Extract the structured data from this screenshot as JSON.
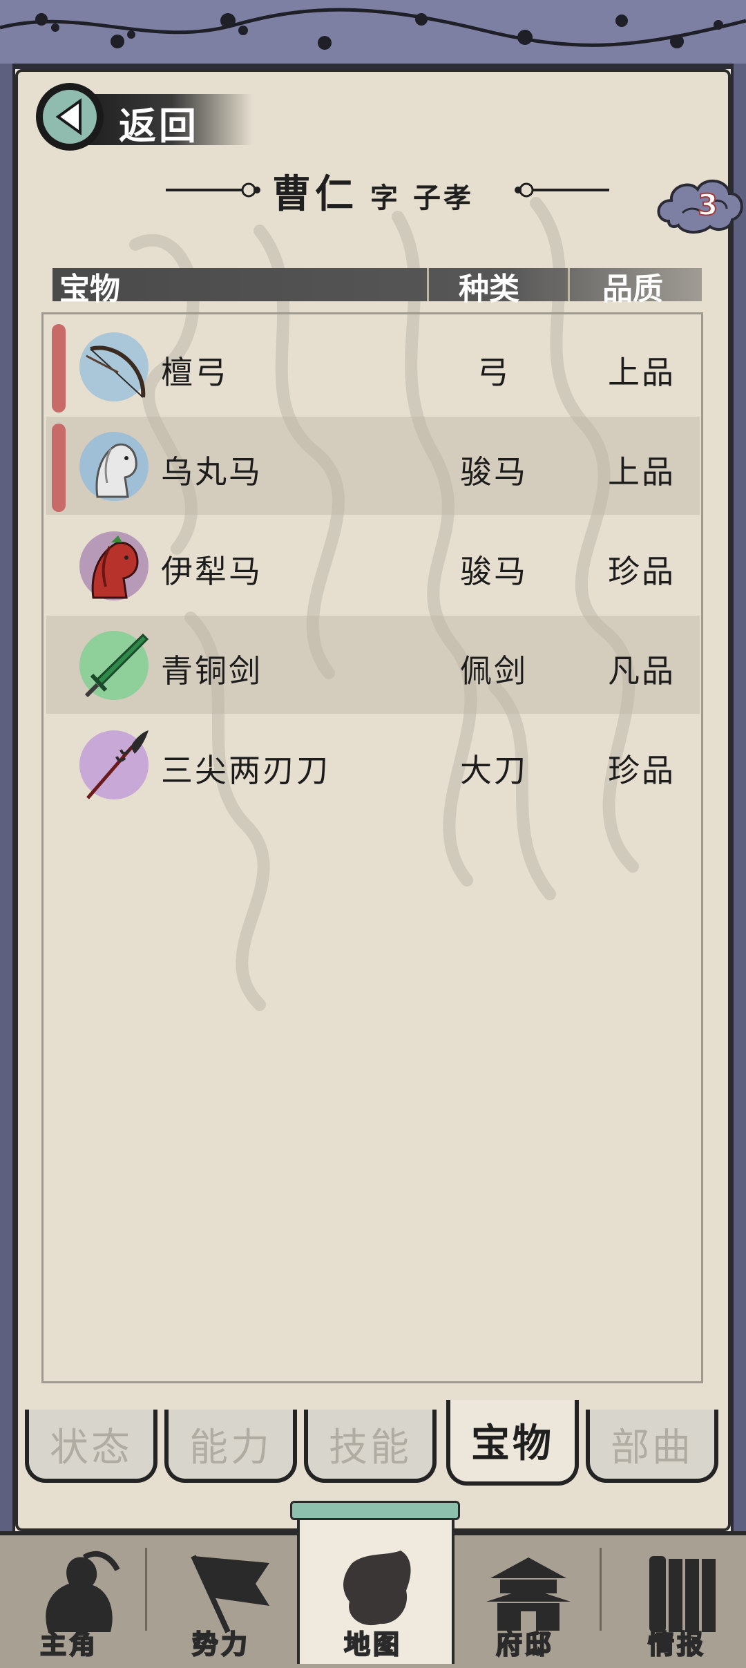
{
  "back_button": {
    "label": "返回"
  },
  "title": {
    "name": "曹仁",
    "zi_prefix": "字",
    "zi": "子孝"
  },
  "badge": {
    "count": "3"
  },
  "table": {
    "headers": {
      "item": "宝物",
      "type": "种类",
      "quality": "品质"
    },
    "rows": [
      {
        "name": "檀弓",
        "type": "弓",
        "quality": "上品",
        "icon": "bow-icon",
        "marked": true,
        "alt": false
      },
      {
        "name": "乌丸马",
        "type": "骏马",
        "quality": "上品",
        "icon": "white-horse-icon",
        "marked": true,
        "alt": true
      },
      {
        "name": "伊犁马",
        "type": "骏马",
        "quality": "珍品",
        "icon": "red-horse-icon",
        "marked": false,
        "alt": false
      },
      {
        "name": "青铜剑",
        "type": "佩剑",
        "quality": "凡品",
        "icon": "bronze-sword-icon",
        "marked": false,
        "alt": true
      },
      {
        "name": "三尖两刃刀",
        "type": "大刀",
        "quality": "珍品",
        "icon": "glaive-icon",
        "marked": false,
        "alt": false
      }
    ]
  },
  "tabs": [
    {
      "label": "状态",
      "active": false
    },
    {
      "label": "能力",
      "active": false
    },
    {
      "label": "技能",
      "active": false
    },
    {
      "label": "宝物",
      "active": true
    },
    {
      "label": "部曲",
      "active": false
    }
  ],
  "bottom_nav": [
    {
      "label": "主角",
      "icon": "warrior-icon",
      "active": false
    },
    {
      "label": "势力",
      "icon": "flag-icon",
      "active": false
    },
    {
      "label": "地图",
      "icon": "map-icon",
      "active": true
    },
    {
      "label": "府邸",
      "icon": "mansion-icon",
      "active": false
    },
    {
      "label": "情报",
      "icon": "scroll-icon",
      "active": false
    }
  ],
  "colors": {
    "paper": "#e6dfcf",
    "frame": "#7e80a3",
    "marker": "#c86b68",
    "accent_teal": "#8fbcae"
  }
}
